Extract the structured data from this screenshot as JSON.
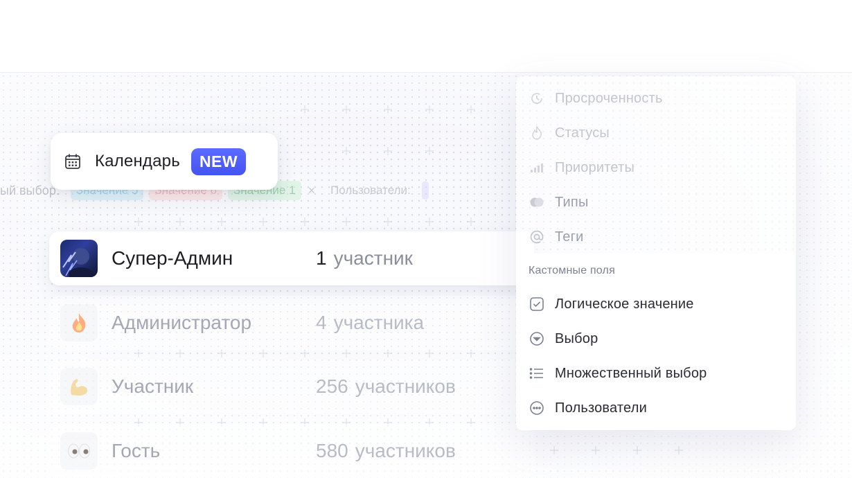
{
  "calendar": {
    "label": "Календарь",
    "badge": "NEW"
  },
  "filter_bar": {
    "label": "ый выбор:",
    "chips": [
      "Значение 5",
      "Значение 6",
      "Значение 1"
    ],
    "clear": "×",
    "users_label": "Пользователи:"
  },
  "roles": [
    {
      "name": "Супер-Админ",
      "count": "1",
      "unit": "участник",
      "icon": "avatar-photo"
    },
    {
      "name": "Администратор",
      "count": "4",
      "unit": "участника",
      "icon": "fire-emoji"
    },
    {
      "name": "Участник",
      "count": "256",
      "unit": "участников",
      "icon": "flexed-biceps-emoji"
    },
    {
      "name": "Гость",
      "count": "580",
      "unit": "участников",
      "icon": "eyes-emoji"
    }
  ],
  "dropdown": {
    "system_items": [
      {
        "label": "Просроченность",
        "icon": "clock-icon"
      },
      {
        "label": "Статусы",
        "icon": "flame-icon"
      },
      {
        "label": "Приоритеты",
        "icon": "bars-icon"
      },
      {
        "label": "Типы",
        "icon": "types-icon"
      },
      {
        "label": "Теги",
        "icon": "at-icon"
      }
    ],
    "section_title": "Кастомные поля",
    "custom_items": [
      {
        "label": "Логическое значение",
        "icon": "checkbox-icon"
      },
      {
        "label": "Выбор",
        "icon": "select-icon"
      },
      {
        "label": "Множественный выбор",
        "icon": "list-icon"
      },
      {
        "label": "Пользователи",
        "icon": "users-icon"
      }
    ]
  },
  "colors": {
    "accent": "#4f5ef8",
    "chip_blue": "#bfe9f6",
    "chip_red": "#ffd3d3",
    "chip_green": "#c7f0cf"
  }
}
